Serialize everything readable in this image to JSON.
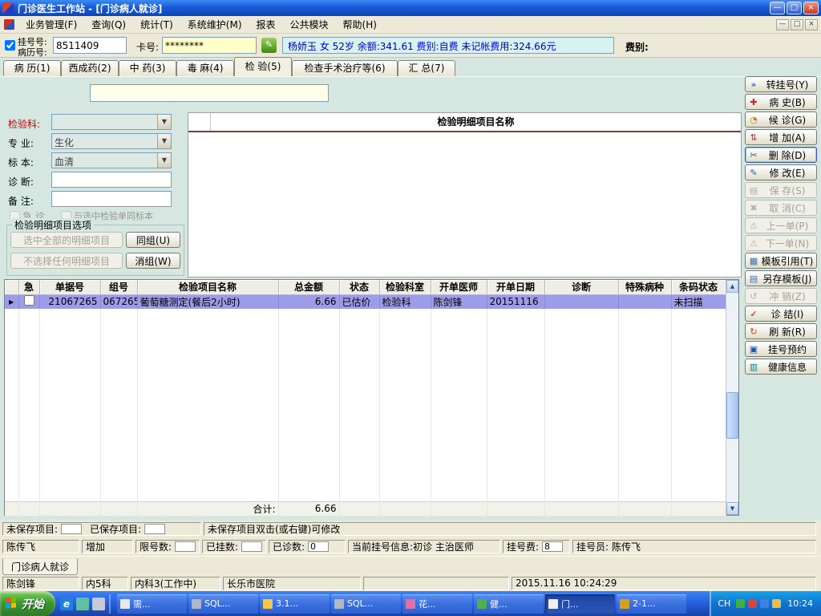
{
  "window": {
    "title": "门诊医生工作站 - [门诊病人就诊]",
    "minimize": "—",
    "restore": "□",
    "close": "×"
  },
  "menu": {
    "items": [
      "业务管理(F)",
      "查询(Q)",
      "统计(T)",
      "系统维护(M)",
      "报表",
      "公共模块",
      "帮助(H)"
    ]
  },
  "toolbar": {
    "reg_label": "挂号号:",
    "record_label": "病历号:",
    "record_value": "8511409",
    "card_label": "卡号:",
    "card_value": "********",
    "patient_info": "杨娇玉  女  52岁  余额:341.61  费别:自费  未记帐费用:324.66元",
    "fee_label": "费别:"
  },
  "tabs": [
    "病 历(1)",
    "西成药(2)",
    "中 药(3)",
    "毒 麻(4)",
    "检 验(5)",
    "检查手术治疗等(6)",
    "汇 总(7)"
  ],
  "form": {
    "lab_label": "检验科:",
    "specialty_label": "专  业:",
    "specialty_value": "生化",
    "specimen_label": "标  本:",
    "specimen_value": "血清",
    "diagnosis_label": "诊  断:",
    "note_label": "备  注:",
    "urgent_label": "急 诊",
    "same_specimen_label": "与选中检验单同标本",
    "options_title": "检验明细项目选项",
    "select_all": "选中全部的明细项目",
    "select_none": "不选择任何明细项目",
    "same_group": "同组(U)",
    "ungroup": "消组(W)"
  },
  "detail_panel": {
    "title": "检验明细项目名称"
  },
  "table": {
    "headers": [
      "急",
      "单据号",
      "组号",
      "检验项目名称",
      "总金额",
      "状态",
      "检验科室",
      "开单医师",
      "开单日期",
      "诊断",
      "特殊病种",
      "条码状态"
    ],
    "row": {
      "receipt_no": "21067265",
      "group_no": "067265",
      "item_name": "葡萄糖测定(餐后2小时)",
      "amount": "6.66",
      "status": "已估价",
      "lab_dept": "检验科",
      "doctor": "陈剑锋",
      "order_date": "20151116",
      "diagnosis": "",
      "special_disease": "",
      "barcode_status": "未扫描"
    },
    "total_label": "合计:",
    "total_value": "6.66"
  },
  "ui": {
    "dropdown_arrow": "▼",
    "scroll_up": "▲",
    "scroll_down": "▼",
    "row_marker": "▶"
  },
  "sidebar": {
    "buttons": [
      {
        "label": "转挂号(Y)",
        "icon": "»"
      },
      {
        "label": "病  史(B)",
        "icon": "✚"
      },
      {
        "label": "候  诊(G)",
        "icon": "◔"
      },
      {
        "label": "增  加(A)",
        "icon": "⇅"
      },
      {
        "label": "删  除(D)",
        "icon": "✂"
      },
      {
        "label": "修  改(E)",
        "icon": "✎"
      },
      {
        "label": "保  存(S)",
        "icon": "▤"
      },
      {
        "label": "取  消(C)",
        "icon": "✖"
      },
      {
        "label": "上一单(P)",
        "icon": "⚠"
      },
      {
        "label": "下一单(N)",
        "icon": "⚠"
      },
      {
        "label": "模板引用(T)",
        "icon": "▦"
      },
      {
        "label": "另存模板(J)",
        "icon": "▤"
      },
      {
        "label": "冲  销(Z)",
        "icon": "↺"
      },
      {
        "label": "诊  结(I)",
        "icon": "✓"
      },
      {
        "label": "刷  新(R)",
        "icon": "↻"
      },
      {
        "label": "挂号预约",
        "icon": "▣"
      },
      {
        "label": "健康信息",
        "icon": "▥"
      }
    ]
  },
  "status1": {
    "unsaved_label": "未保存项目:",
    "saved_label": "已保存项目:",
    "hint": "未保存项目双击(或右键)可修改"
  },
  "status2": {
    "operator": "陈传飞",
    "mode": "增加",
    "limit_label": "限号数:",
    "registered_label": "已挂数:",
    "seen_label": "已诊数:",
    "seen_value": "0",
    "current_label": "当前挂号信息:",
    "current_value": "初诊 主治医师",
    "fee_label": "挂号费:",
    "fee_value": "8",
    "registrar_label": "挂号员:",
    "registrar_value": "陈传飞"
  },
  "mdi_tab": "门诊病人就诊",
  "status3": {
    "doctor": "陈剑锋",
    "ward": "内5科",
    "dept": "内科3(工作中)",
    "hospital": "长乐市医院",
    "datetime": "2015.11.16 10:24:29"
  },
  "taskbar": {
    "start": "开始",
    "ie_glyph": "e",
    "tasks": [
      {
        "label": "需..."
      },
      {
        "label": "SQL..."
      },
      {
        "label": "3.1..."
      },
      {
        "label": "SQL..."
      },
      {
        "label": "花..."
      },
      {
        "label": "健..."
      },
      {
        "label": "门..."
      },
      {
        "label": "2-1..."
      }
    ],
    "tray": {
      "lang": "CH",
      "time": "10:24"
    }
  }
}
